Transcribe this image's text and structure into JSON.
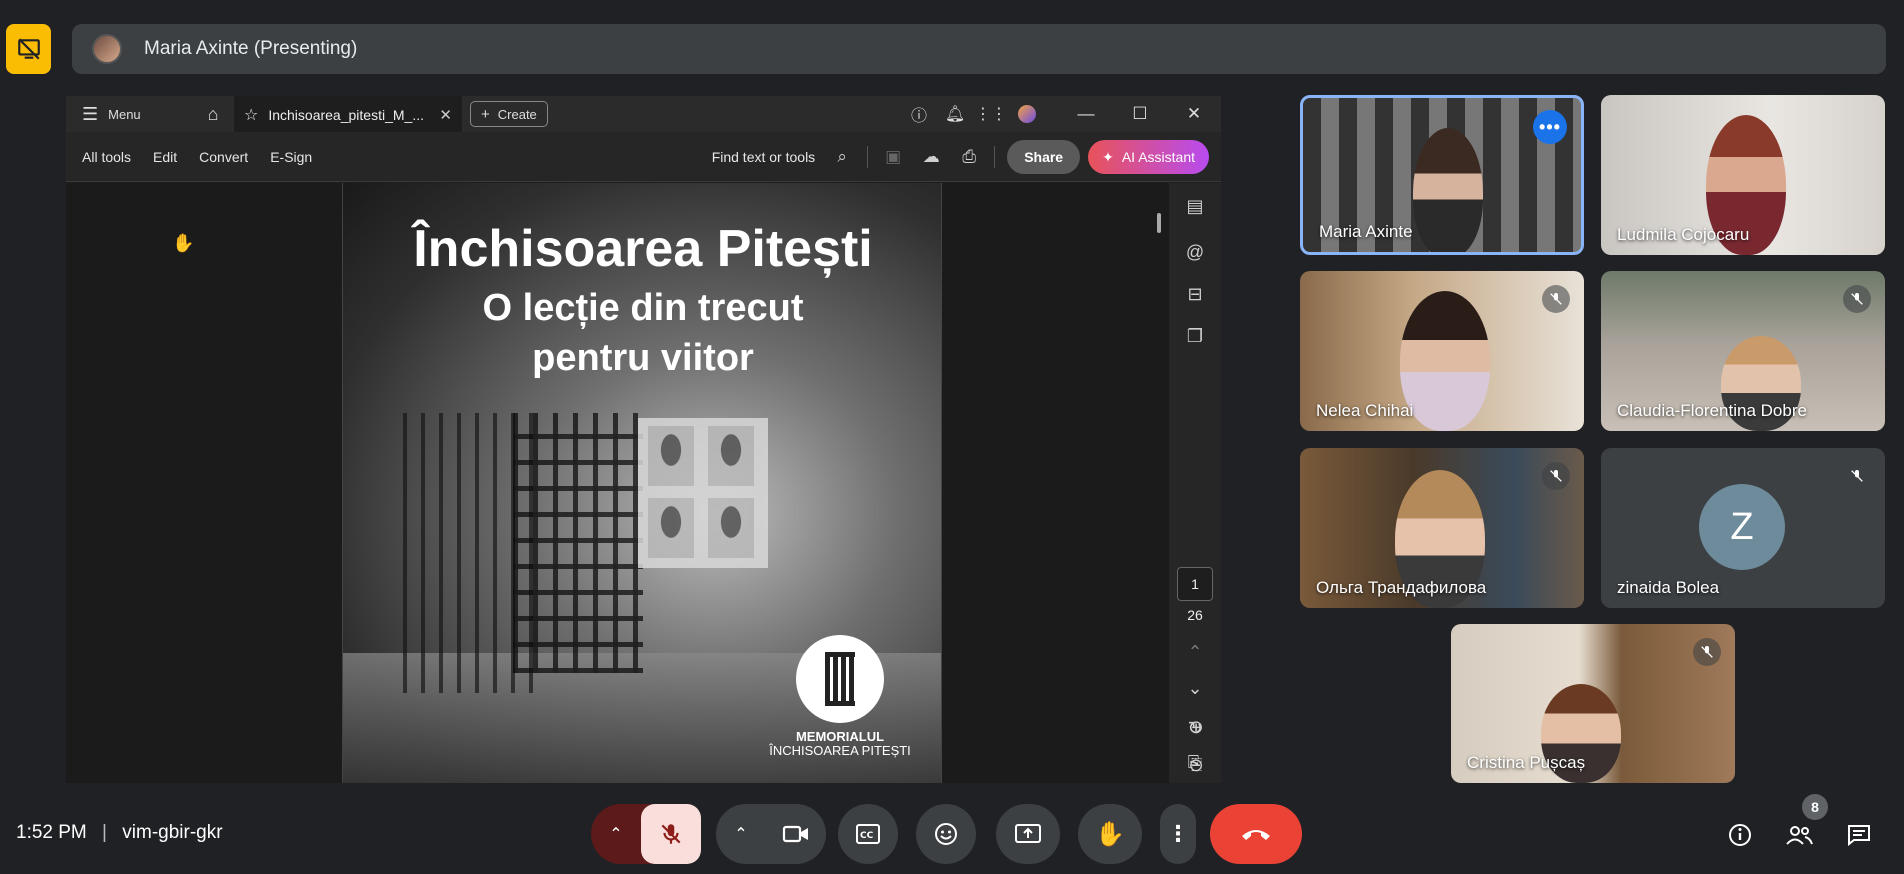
{
  "banner": {
    "presenter_label": "Maria Axinte (Presenting)"
  },
  "acrobat": {
    "menu_label": "Menu",
    "tab_title": "Inchisoarea_pitesti_M_...",
    "create_label": "Create",
    "tools": [
      "All tools",
      "Edit",
      "Convert",
      "E-Sign"
    ],
    "find_label": "Find text or tools",
    "share_label": "Share",
    "ai_label": "AI Assistant",
    "page_current": "1",
    "page_total": "26",
    "document": {
      "title_line1": "Închisoarea Pitești",
      "title_line2": "O lecție din trecut",
      "title_line3": "pentru viitor",
      "logo_line1": "MEMORIALUL",
      "logo_line2": "ÎNCHISOAREA PITEȘTI"
    }
  },
  "participants": [
    {
      "name": "Maria Axinte"
    },
    {
      "name": "Ludmila Cojocaru"
    },
    {
      "name": "Nelea Chihai"
    },
    {
      "name": "Claudia-Florentina Dobre"
    },
    {
      "name": "Ольга Трандафилова"
    },
    {
      "name": "zinaida Bolea",
      "avatar_letter": "Z"
    },
    {
      "name": "Cristina Pușcaș"
    }
  ],
  "bottom": {
    "time": "1:52 PM",
    "separator": "|",
    "meeting_code": "vim-gbir-gkr",
    "people_count": "8"
  },
  "colors": {
    "background": "#202124",
    "stop_presenting": "#fbbc04",
    "end_call": "#ea4335",
    "mic_off_bg": "#f9dedc",
    "active_speaker": "#8ab4f8"
  }
}
